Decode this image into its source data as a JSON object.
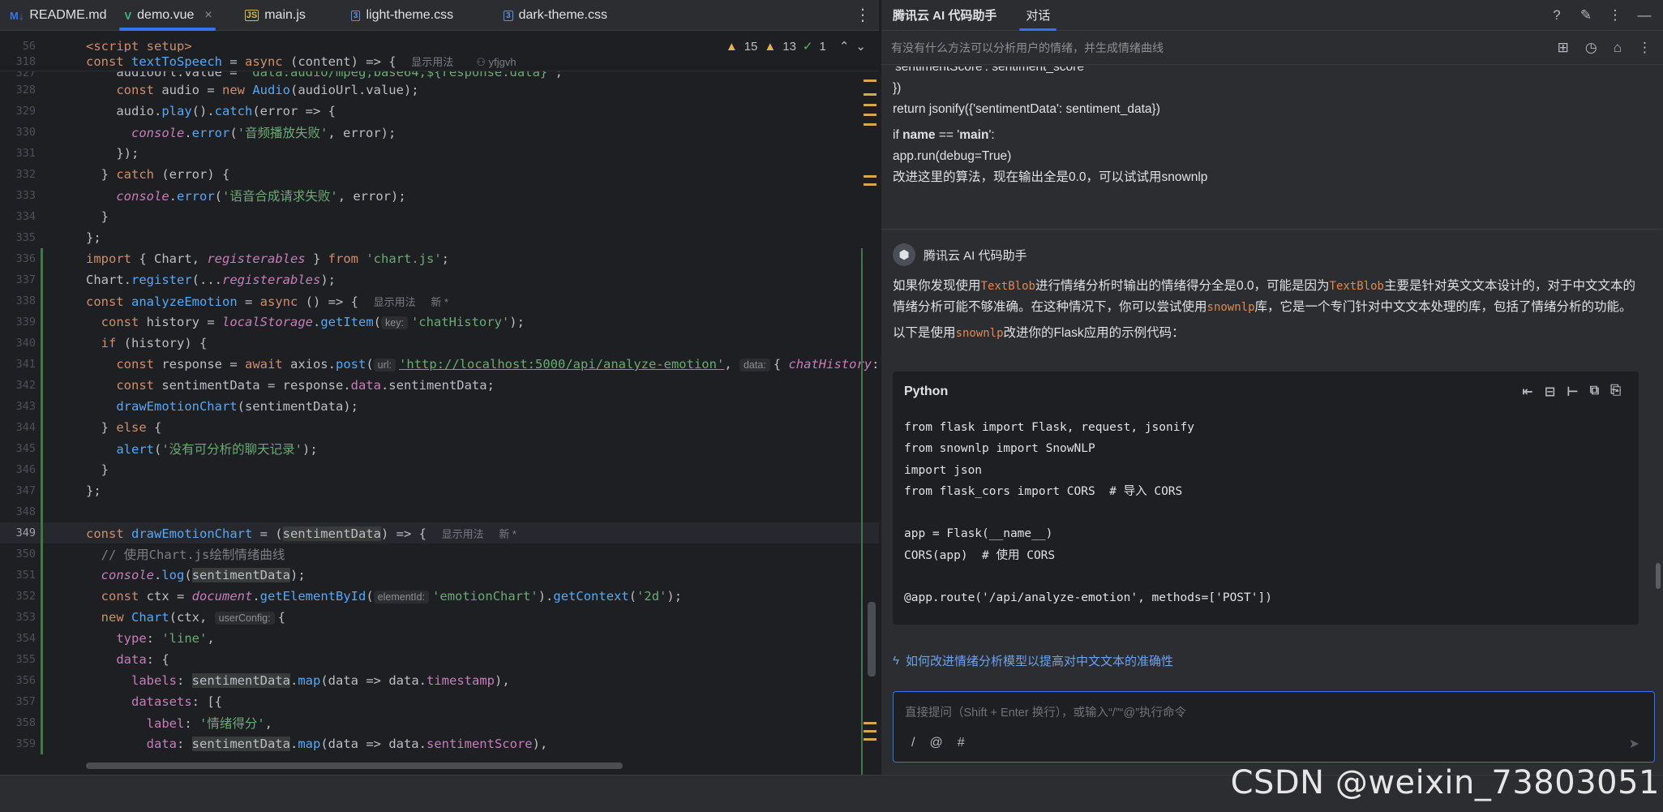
{
  "editor_tabs": [
    {
      "label": "README.md",
      "icon": "M↓",
      "icon_color": "#3574f0"
    },
    {
      "label": "demo.vue",
      "icon": "V",
      "icon_color": "#41b883",
      "active": true
    },
    {
      "label": "main.js",
      "icon": "JS",
      "icon_color": "#d5b648"
    },
    {
      "label": "light-theme.css",
      "icon": "3",
      "icon_color": "#5c8ee6"
    },
    {
      "label": "dark-theme.css",
      "icon": "3",
      "icon_color": "#5c8ee6"
    }
  ],
  "inspections": {
    "warnings": "15",
    "weak_warnings": "13",
    "ok": "1"
  },
  "hints": {
    "show_usage": "显示用法",
    "author": "yfjgvh",
    "new": "新 *",
    "key": "key:",
    "url": "url:",
    "data": "data:",
    "elementId": "elementId:",
    "userConfig": "userConfig:"
  },
  "line_numbers": [
    "56",
    "318",
    "327",
    "328",
    "329",
    "330",
    "331",
    "332",
    "333",
    "334",
    "335",
    "336",
    "337",
    "338",
    "339",
    "340",
    "341",
    "342",
    "343",
    "344",
    "345",
    "346",
    "347",
    "348",
    "349",
    "350",
    "351",
    "352",
    "353",
    "354",
    "355",
    "356",
    "357",
    "358",
    "359"
  ],
  "strings": {
    "script_setup": "<script setup>",
    "audio_err": "'音频播放失败'",
    "tts_err": "'语音合成请求失败'",
    "chartjs": "'chart.js'",
    "chat_history": "'chatHistory'",
    "api_url": "'http://localhost:5000/api/analyze-emotion'",
    "no_history": "'没有可分析的聊天记录'",
    "comment": "// 使用Chart.js绘制情绪曲线",
    "emotion_chart": "'emotionChart'",
    "two_d": "'2d'",
    "line_type": "'line'",
    "label_score": "'情绪得分'"
  },
  "assistant": {
    "title": "腾讯云 AI 代码助手",
    "tab": "对话",
    "question": "有没有什么方法可以分析用户的情绪，并生成情绪曲线",
    "user_lines": [
      "'sentimentScore': sentiment_score",
      "})",
      "return jsonify({'sentimentData': sentiment_data})"
    ],
    "user_if_prefix": "if ",
    "user_if_name": "name",
    "user_if_mid": " == '",
    "user_if_main": "main",
    "user_if_end": "':",
    "user_run": "app.run(debug=True)",
    "user_request": "改进这里的算法，现在输出全是0.0，可以试试用snownlp",
    "bot_name": "腾讯云 AI 代码助手",
    "reply_p1_a": "如果你发现使用",
    "reply_textblob": "TextBlob",
    "reply_p1_b": "进行情绪分析时输出的情绪得分全是0.0，可能是因为",
    "reply_p1_c": "主要是针对英文文本设计的，对于中文文本的情绪分析可能不够准确。在这种情况下，你可以尝试使用",
    "reply_snownlp": "snownlp",
    "reply_p1_d": "库，它是一个专门针对中文文本处理的库，包括了情绪分析的功能。",
    "reply_p2_a": "以下是使用",
    "reply_p2_b": "改进你的Flask应用的示例代码：",
    "code_lang": "Python",
    "code_lines": [
      "from flask import Flask, request, jsonify",
      "from snownlp import SnowNLP",
      "import json",
      "from flask_cors import CORS  # 导入 CORS",
      "",
      "app = Flask(__name__)",
      "CORS(app)  # 使用 CORS",
      "",
      "@app.route('/api/analyze-emotion', methods=['POST'])"
    ],
    "suggestion": "如何改进情绪分析模型以提高对中文文本的准确性",
    "input_placeholder": "直接提问（Shift + Enter 换行），或输入“/”“@”执行命令",
    "input_tools": [
      "/",
      "@",
      "#"
    ]
  },
  "watermark": "CSDN @weixin_73803051"
}
